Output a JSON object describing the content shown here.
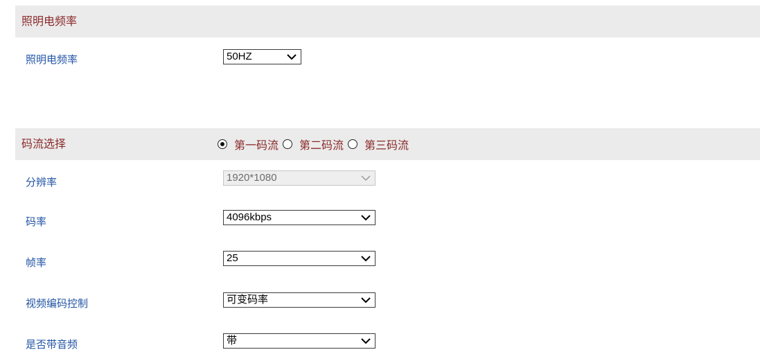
{
  "lighting": {
    "header_title": "照明电频率",
    "frequency_label": "照明电频率",
    "frequency_value": "50HZ"
  },
  "stream": {
    "header_title": "码流选择",
    "options": [
      "第一码流",
      "第二码流",
      "第三码流"
    ],
    "selected_index": 0,
    "fields": {
      "resolution": {
        "label": "分辨率",
        "value": "1920*1080",
        "disabled": true
      },
      "bitrate": {
        "label": "码率",
        "value": "4096kbps"
      },
      "framerate": {
        "label": "帧率",
        "value": "25"
      },
      "encoding_control": {
        "label": "视频编码控制",
        "value": "可变码率"
      },
      "audio": {
        "label": "是否带音频",
        "value": "带"
      }
    }
  },
  "icons": {
    "dropdown": "chevron-down-icon",
    "radio": "radio-icon"
  },
  "colors": {
    "header_bg": "#ebebeb",
    "header_text": "#8b2a2a",
    "label_text": "#2355a6",
    "disabled_bg": "#eeeeee"
  }
}
